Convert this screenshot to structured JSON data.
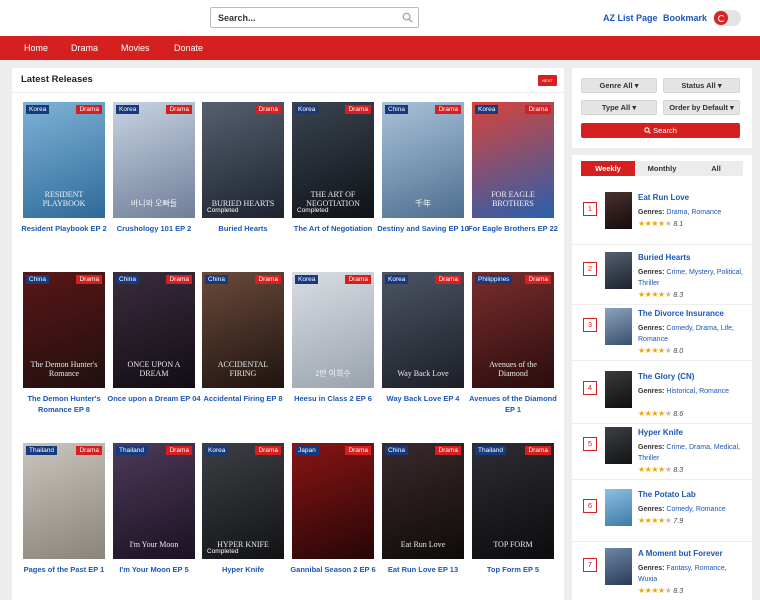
{
  "search": {
    "placeholder": "Search..."
  },
  "header": {
    "az_list": "AZ List Page",
    "bookmark": "Bookmark"
  },
  "nav": {
    "items": [
      "Home",
      "Drama",
      "Movies",
      "Donate"
    ]
  },
  "latest": {
    "title": "Latest Releases",
    "next_label": "NEXT",
    "cards": [
      {
        "country": "Korea",
        "type": "Drama",
        "title": "Resident Playbook EP 2",
        "poster_text": "RESIDENT PLAYBOOK",
        "status": "",
        "colors": [
          "#7fb3d6",
          "#2e6a9a"
        ]
      },
      {
        "country": "Korea",
        "type": "Drama",
        "title": "Crushology 101 EP 2",
        "poster_text": "바니와 오빠들",
        "status": "",
        "colors": [
          "#c7d3e3",
          "#6f7f99"
        ]
      },
      {
        "country": "",
        "type": "Drama",
        "title": "Buried Hearts",
        "poster_text": "BURIED HEARTS",
        "status": "Completed",
        "colors": [
          "#55606e",
          "#1d2330"
        ]
      },
      {
        "country": "Korea",
        "type": "Drama",
        "title": "The Art of Negotiation",
        "poster_text": "THE ART OF NEGOTIATION",
        "status": "Completed",
        "colors": [
          "#3a4450",
          "#0f1216"
        ]
      },
      {
        "country": "China",
        "type": "Drama",
        "title": "Destiny and Saving EP 10",
        "poster_text": "千年",
        "status": "",
        "colors": [
          "#a9c2d9",
          "#4f6f8f"
        ]
      },
      {
        "country": "Korea",
        "type": "Drama",
        "title": "For Eagle Brothers EP 22",
        "poster_text": "FOR EAGLE BROTHERS",
        "status": "",
        "colors": [
          "#d7443a",
          "#2a5fae"
        ]
      },
      {
        "country": "China",
        "type": "Drama",
        "title": "The Demon Hunter's Romance EP 8",
        "poster_text": "The Demon Hunter's Romance",
        "status": "",
        "colors": [
          "#5a1616",
          "#201010"
        ]
      },
      {
        "country": "China",
        "type": "Drama",
        "title": "Once upon a Dream EP 04",
        "poster_text": "ONCE UPON A DREAM",
        "status": "",
        "colors": [
          "#3a2c3c",
          "#120d14"
        ]
      },
      {
        "country": "China",
        "type": "Drama",
        "title": "Accidental Firing EP 8",
        "poster_text": "ACCIDENTAL FIRING",
        "status": "",
        "colors": [
          "#6b4a3a",
          "#1e1410"
        ]
      },
      {
        "country": "Korea",
        "type": "Drama",
        "title": "Heesu in Class 2 EP 6",
        "poster_text": "2반 이희수",
        "status": "",
        "colors": [
          "#d9dde3",
          "#9aa3ad"
        ]
      },
      {
        "country": "Korea",
        "type": "Drama",
        "title": "Way Back Love EP 4",
        "poster_text": "Way Back Love",
        "status": "",
        "colors": [
          "#4c5464",
          "#1c1f26"
        ]
      },
      {
        "country": "Philippines",
        "type": "Drama",
        "title": "Avenues of the Diamond EP 1",
        "poster_text": "Avenues of the Diamond",
        "status": "",
        "colors": [
          "#7a2d2d",
          "#2a0d0d"
        ]
      },
      {
        "country": "Thailand",
        "type": "Drama",
        "title": "Pages of the Past EP 1",
        "poster_text": "",
        "status": "",
        "colors": [
          "#c9c5bd",
          "#8a847a"
        ]
      },
      {
        "country": "Thailand",
        "type": "Drama",
        "title": "I'm Your Moon EP 5",
        "poster_text": "I'm Your Moon",
        "status": "",
        "colors": [
          "#4d3a5a",
          "#1a1222"
        ]
      },
      {
        "country": "Korea",
        "type": "Drama",
        "title": "Hyper Knife",
        "poster_text": "HYPER KNIFE",
        "status": "Completed",
        "colors": [
          "#3c3f44",
          "#121315"
        ]
      },
      {
        "country": "Japan",
        "type": "Drama",
        "title": "Gannibal Season 2 EP 6",
        "poster_text": "",
        "status": "",
        "colors": [
          "#8a1414",
          "#260606"
        ]
      },
      {
        "country": "China",
        "type": "Drama",
        "title": "Eat Run Love EP 13",
        "poster_text": "Eat Run Love",
        "status": "",
        "colors": [
          "#3a2a2a",
          "#0f0b0b"
        ]
      },
      {
        "country": "Thailand",
        "type": "Drama",
        "title": "Top Form EP 5",
        "poster_text": "TOP FORM",
        "status": "",
        "colors": [
          "#2d2d33",
          "#0c0c0e"
        ]
      }
    ]
  },
  "filters": {
    "genre": "Genre All",
    "status": "Status All",
    "type": "Type All",
    "order": "Order by Default",
    "search_btn": "Search"
  },
  "popular": {
    "tabs": [
      "Weekly",
      "Monthly",
      "All"
    ],
    "items": [
      {
        "rank": "1",
        "title": "Eat Run Love",
        "genres": [
          "Drama",
          "Romance"
        ],
        "rating": "8.1",
        "stars": 4,
        "colors": [
          "#4a3030",
          "#160c0c"
        ]
      },
      {
        "rank": "2",
        "title": "Buried Hearts",
        "genres": [
          "Crime",
          "Mystery",
          "Political",
          "Thriller"
        ],
        "rating": "8.3",
        "stars": 4,
        "colors": [
          "#55606e",
          "#1d2330"
        ]
      },
      {
        "rank": "3",
        "title": "The Divorce Insurance",
        "genres": [
          "Comedy",
          "Drama",
          "Life",
          "Romance"
        ],
        "rating": "8.0",
        "stars": 4,
        "colors": [
          "#8aa2bd",
          "#38506a"
        ]
      },
      {
        "rank": "4",
        "title": "The Glory (CN)",
        "genres": [
          "Historical",
          "Romance"
        ],
        "rating": "8.6",
        "stars": 4,
        "colors": [
          "#3b3b3b",
          "#101010"
        ]
      },
      {
        "rank": "5",
        "title": "Hyper Knife",
        "genres": [
          "Crime",
          "Drama",
          "Medical",
          "Thriller"
        ],
        "rating": "8.3",
        "stars": 4,
        "colors": [
          "#3c3f44",
          "#121315"
        ]
      },
      {
        "rank": "6",
        "title": "The Potato Lab",
        "genres": [
          "Comedy",
          "Romance"
        ],
        "rating": "7.9",
        "stars": 4,
        "colors": [
          "#8cc0e0",
          "#3d7aa8"
        ]
      },
      {
        "rank": "7",
        "title": "A Moment but Forever",
        "genres": [
          "Fantasy",
          "Romance",
          "Wuxia"
        ],
        "rating": "8.3",
        "stars": 4,
        "colors": [
          "#6b86a8",
          "#2b3c55"
        ]
      }
    ]
  }
}
